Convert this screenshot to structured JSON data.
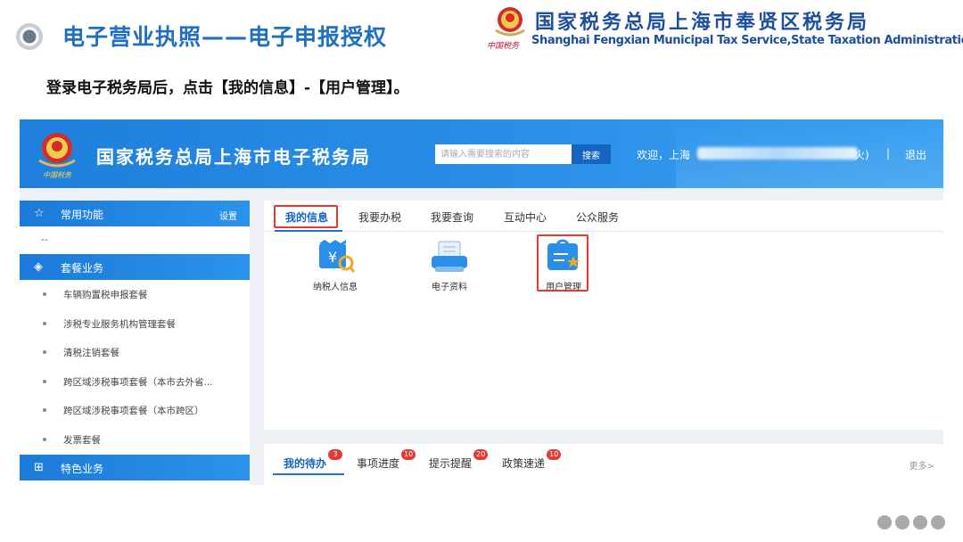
{
  "slide": {
    "title": "电子营业执照——电子申报授权",
    "instruction": "登录电子税务局后，点击【我的信息】-【用户管理】。",
    "bureau_cn": "国家税务总局上海市奉贤区税务局",
    "bureau_en": "Shanghai Fengxian Municipal Tax Service,State Taxation Administration",
    "bureau_sign": "中国税务"
  },
  "site": {
    "logo_sign": "中国税务",
    "title": "国家税务总局上海市电子税务局",
    "search": {
      "placeholder": "请输入需要搜索的内容",
      "button": "搜索"
    },
    "welcome": "欢迎，上海",
    "name_suffix": "火)",
    "separator": "|",
    "logout": "退出"
  },
  "sidebar": {
    "common": {
      "label": "常用功能",
      "settings": "设置",
      "empty": "--"
    },
    "packages": {
      "label": "套餐业务",
      "items": [
        "车辆购置税申报套餐",
        "涉税专业服务机构管理套餐",
        "清税注销套餐",
        "跨区域涉税事项套餐（本市去外省...",
        "跨区域涉税事项套餐（本市跨区）",
        "发票套餐"
      ]
    },
    "special": {
      "label": "特色业务"
    }
  },
  "main": {
    "tabs": [
      "我的信息",
      "我要办税",
      "我要查询",
      "互动中心",
      "公众服务"
    ],
    "apps": [
      {
        "label": "纳税人信息",
        "icon": "taxpayer-info-icon"
      },
      {
        "label": "电子资料",
        "icon": "electronic-documents-icon"
      },
      {
        "label": "用户管理",
        "icon": "user-management-icon"
      }
    ]
  },
  "bottom": {
    "tabs": [
      {
        "label": "我的待办",
        "badge": "3"
      },
      {
        "label": "事项进度",
        "badge": "10"
      },
      {
        "label": "提示提醒",
        "badge": "20"
      },
      {
        "label": "政策速递",
        "badge": "10"
      }
    ],
    "more": "更多>"
  },
  "colors": {
    "brand_blue": "#1f7fdc",
    "title_blue": "#1f6fc2",
    "highlight_red": "#e53935"
  }
}
